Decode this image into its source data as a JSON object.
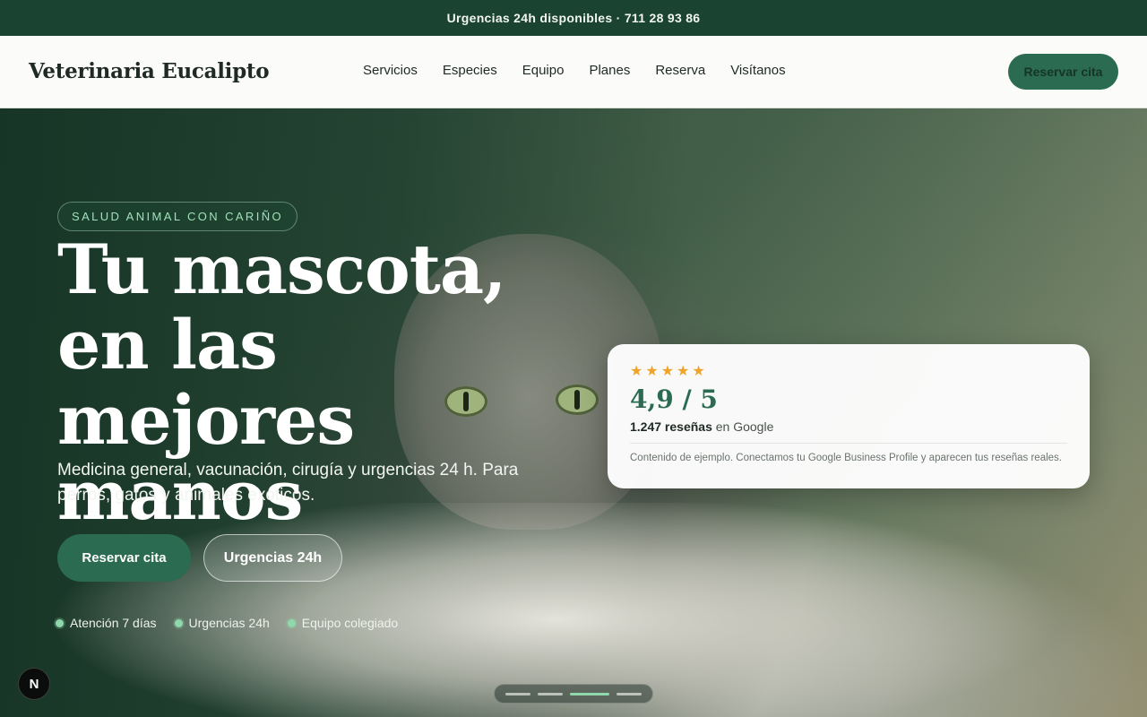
{
  "topbar": {
    "text": "Urgencias 24h disponibles · 711 28 93 86"
  },
  "header": {
    "brand": "Veterinaria Eucalipto",
    "nav": [
      "Servicios",
      "Especies",
      "Equipo",
      "Planes",
      "Reserva",
      "Visítanos"
    ],
    "cta": "Reservar cita"
  },
  "hero": {
    "badge": "SALUD ANIMAL CON CARIÑO",
    "headline": "Tu mascota, en las mejores manos",
    "subtitle": "Medicina general, vacunación, cirugía y urgencias 24 h. Para perros, gatos y animales exóticos.",
    "primary_cta": "Reservar cita",
    "secondary_cta": "Urgencias 24h",
    "features": [
      "Atención 7 días",
      "Urgencias 24h",
      "Equipo colegiado"
    ]
  },
  "review_card": {
    "stars": 5,
    "rating": "4,9 / 5",
    "count": "1.247 reseñas",
    "source": "en Google",
    "note": "Contenido de ejemplo. Conectamos tu Google Business Profile y aparecen tus reseñas reales.",
    "star_color": "#f0a32a"
  },
  "carousel": {
    "total": 4,
    "active": 3
  },
  "corner_badge": {
    "letter": "N"
  },
  "colors": {
    "brand_green": "#2a6b51",
    "topbar": "#1b4332",
    "accent_mint": "#8fd8ac"
  }
}
